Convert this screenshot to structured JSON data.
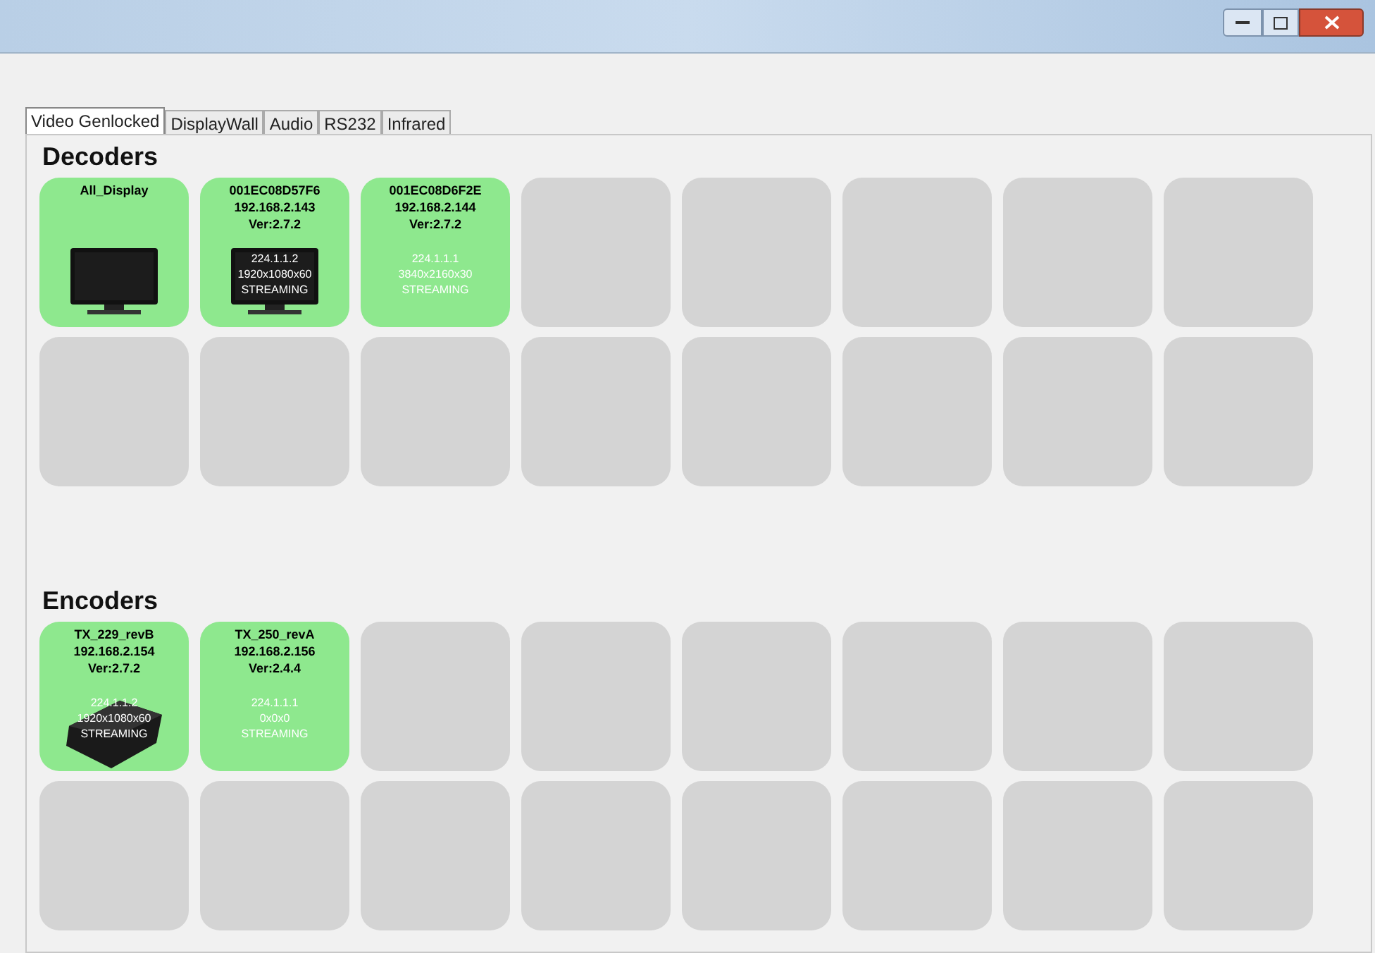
{
  "tabs": [
    {
      "label": "Video Genlocked",
      "selected": true
    },
    {
      "label": "DisplayWall",
      "selected": false
    },
    {
      "label": "Audio",
      "selected": false
    },
    {
      "label": "RS232",
      "selected": false
    },
    {
      "label": "Infrared",
      "selected": false
    }
  ],
  "sections": [
    {
      "title": "Decoders",
      "tiles": [
        {
          "kind": "monitor",
          "name": "All_Display"
        },
        {
          "kind": "monitor",
          "name": "001EC08D57F6",
          "ip": "192.168.2.143",
          "version": "Ver:2.7.2",
          "lines": [
            "224.1.1.2",
            "1920x1080x60",
            "STREAMING"
          ]
        },
        {
          "kind": "plain",
          "name": "001EC08D6F2E",
          "ip": "192.168.2.144",
          "version": "Ver:2.7.2",
          "lines": [
            "224.1.1.1",
            "3840x2160x30",
            "STREAMING"
          ]
        },
        {
          "kind": "empty"
        },
        {
          "kind": "empty"
        },
        {
          "kind": "empty"
        },
        {
          "kind": "empty"
        },
        {
          "kind": "empty"
        },
        {
          "kind": "empty"
        },
        {
          "kind": "empty"
        },
        {
          "kind": "empty"
        },
        {
          "kind": "empty"
        },
        {
          "kind": "empty"
        },
        {
          "kind": "empty"
        },
        {
          "kind": "empty"
        },
        {
          "kind": "empty"
        }
      ]
    },
    {
      "title": "Encoders",
      "tiles": [
        {
          "kind": "box",
          "name": "TX_229_revB",
          "ip": "192.168.2.154",
          "version": "Ver:2.7.2",
          "lines": [
            "224.1.1.2",
            "1920x1080x60",
            "STREAMING"
          ]
        },
        {
          "kind": "plain",
          "name": "TX_250_revA",
          "ip": "192.168.2.156",
          "version": "Ver:2.4.4",
          "lines": [
            "224.1.1.1",
            "0x0x0",
            "STREAMING"
          ]
        },
        {
          "kind": "empty"
        },
        {
          "kind": "empty"
        },
        {
          "kind": "empty"
        },
        {
          "kind": "empty"
        },
        {
          "kind": "empty"
        },
        {
          "kind": "empty"
        },
        {
          "kind": "empty"
        },
        {
          "kind": "empty"
        },
        {
          "kind": "empty"
        },
        {
          "kind": "empty"
        },
        {
          "kind": "empty"
        },
        {
          "kind": "empty"
        },
        {
          "kind": "empty"
        },
        {
          "kind": "empty"
        }
      ]
    }
  ]
}
